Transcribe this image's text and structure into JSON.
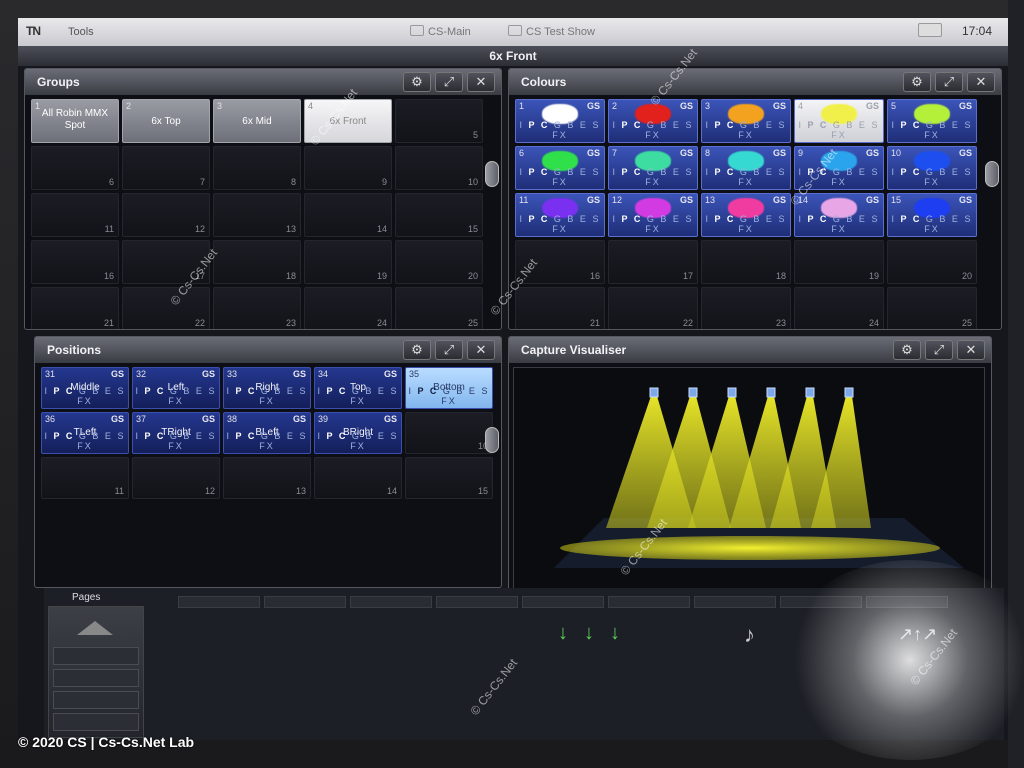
{
  "topbar": {
    "tools_label": "Tools",
    "tabs": [
      "CS-Main",
      "CS Test Show"
    ],
    "clock": "17:04"
  },
  "page_title": "6x Front",
  "groups": {
    "title": "Groups",
    "cells": [
      {
        "num": "1",
        "name": "All Robin MMX Spot"
      },
      {
        "num": "2",
        "name": "6x Top"
      },
      {
        "num": "3",
        "name": "6x Mid"
      },
      {
        "num": "4",
        "name": "6x Front",
        "selected": true
      },
      {
        "num": "5"
      },
      {
        "num": "6"
      },
      {
        "num": "7"
      },
      {
        "num": "8"
      },
      {
        "num": "9"
      },
      {
        "num": "10"
      },
      {
        "num": "11"
      },
      {
        "num": "12"
      },
      {
        "num": "13"
      },
      {
        "num": "14"
      },
      {
        "num": "15"
      },
      {
        "num": "16"
      },
      {
        "num": "17"
      },
      {
        "num": "18"
      },
      {
        "num": "19"
      },
      {
        "num": "20"
      },
      {
        "num": "21"
      },
      {
        "num": "22"
      },
      {
        "num": "23"
      },
      {
        "num": "24"
      },
      {
        "num": "25"
      }
    ]
  },
  "colours": {
    "title": "Colours",
    "attrs": "I P C G B E S FX",
    "gs": "GS",
    "cells": [
      {
        "num": "1",
        "color": "#ffffff"
      },
      {
        "num": "2",
        "color": "#e2201c"
      },
      {
        "num": "3",
        "color": "#f2a21e"
      },
      {
        "num": "4",
        "color": "#f1f04a",
        "selected": true
      },
      {
        "num": "5",
        "color": "#b4f03a"
      },
      {
        "num": "6",
        "color": "#2fe04a"
      },
      {
        "num": "7",
        "color": "#3ddca0"
      },
      {
        "num": "8",
        "color": "#36d8d2"
      },
      {
        "num": "9",
        "color": "#2aa4ec"
      },
      {
        "num": "10",
        "color": "#1d4ff0"
      },
      {
        "num": "11",
        "color": "#7a30f0"
      },
      {
        "num": "12",
        "color": "#d23ae2"
      },
      {
        "num": "13",
        "color": "#f03ca0"
      },
      {
        "num": "14",
        "color": "#e8a6e6"
      },
      {
        "num": "15",
        "color": "#1e3ef2"
      },
      {
        "num": "16"
      },
      {
        "num": "17"
      },
      {
        "num": "18"
      },
      {
        "num": "19"
      },
      {
        "num": "20"
      },
      {
        "num": "21"
      },
      {
        "num": "22"
      },
      {
        "num": "23"
      },
      {
        "num": "24"
      },
      {
        "num": "25"
      }
    ]
  },
  "positions": {
    "title": "Positions",
    "attrs": "I P C G B E S FX",
    "gs": "GS",
    "cells": [
      {
        "num": "31",
        "name": "Middle",
        "gs": true
      },
      {
        "num": "32",
        "name": "Left",
        "gs": true
      },
      {
        "num": "33",
        "name": "Right",
        "gs": true
      },
      {
        "num": "34",
        "name": "Top",
        "gs": true
      },
      {
        "num": "35",
        "name": "Bottom",
        "selected": true
      },
      {
        "num": "36",
        "name": "TLeft",
        "gs": true
      },
      {
        "num": "37",
        "name": "TRight",
        "gs": true
      },
      {
        "num": "38",
        "name": "BLeft",
        "gs": true
      },
      {
        "num": "39",
        "name": "BRight",
        "gs": true
      },
      {
        "num": "10"
      },
      {
        "num": "11"
      },
      {
        "num": "12"
      },
      {
        "num": "13"
      },
      {
        "num": "14"
      },
      {
        "num": "15"
      }
    ]
  },
  "visualiser": {
    "title": "Capture Visualiser"
  },
  "bottom": {
    "pages_label": "Pages"
  },
  "watermark": "© Cs-Cs.Net",
  "copyright": "© 2020 CS | Cs-Cs.Net Lab",
  "colors": {
    "accent_blue": "#2a3fa6",
    "beam": "#f2f02a"
  }
}
